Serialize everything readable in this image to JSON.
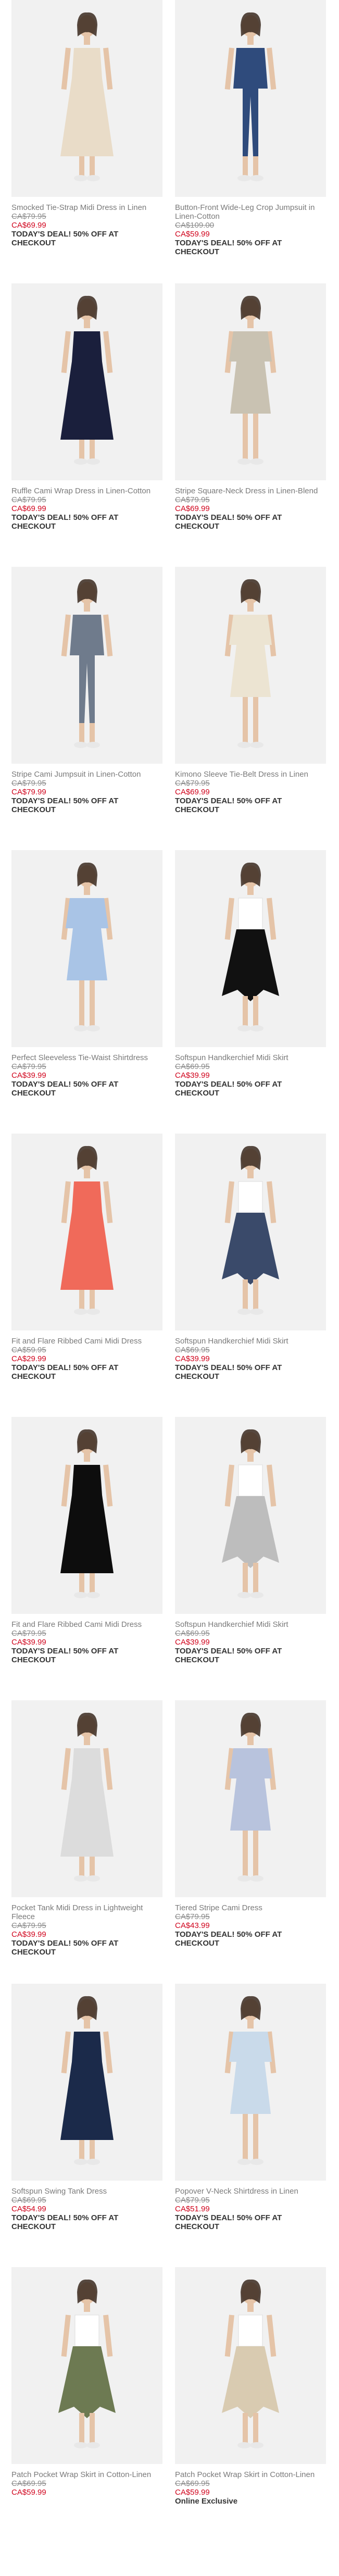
{
  "products": [
    {
      "name": "Smocked Tie-Strap Midi Dress in Linen",
      "original_price": "CA$79.95",
      "sale_price": "CA$69.99",
      "promo": "TODAY'S DEAL! 50% OFF AT CHECKOUT",
      "dress_color": "#e9dcc8",
      "bg": "#f1f1f1",
      "style": "dress"
    },
    {
      "name": "Button-Front Wide-Leg Crop Jumpsuit in Linen-Cotton",
      "original_price": "CA$109.00",
      "sale_price": "CA$59.99",
      "promo": "TODAY'S DEAL! 50% OFF AT CHECKOUT",
      "dress_color": "#2f4b7c",
      "bg": "#f1f1f1",
      "style": "jumpsuit"
    },
    {
      "name": "Ruffle Cami Wrap Dress in Linen-Cotton",
      "original_price": "CA$79.95",
      "sale_price": "CA$69.99",
      "promo": "TODAY'S DEAL! 50% OFF AT CHECKOUT",
      "dress_color": "#1a1f3c",
      "bg": "#f1f1f1",
      "style": "dress"
    },
    {
      "name": "Stripe Square-Neck Dress in Linen-Blend",
      "original_price": "CA$79.95",
      "sale_price": "CA$69.99",
      "promo": "TODAY'S DEAL! 50% OFF AT CHECKOUT",
      "dress_color": "#c9c2b2",
      "bg": "#f1f1f1",
      "style": "short"
    },
    {
      "name": "Stripe Cami Jumpsuit in Linen-Cotton",
      "original_price": "CA$79.95",
      "sale_price": "CA$79.99",
      "promo": "TODAY'S DEAL! 50% OFF AT CHECKOUT",
      "dress_color": "#6f7b8c",
      "bg": "#f1f1f1",
      "style": "jumpsuit"
    },
    {
      "name": "Kimono Sleeve Tie-Belt Dress in Linen",
      "original_price": "CA$79.95",
      "sale_price": "CA$69.99",
      "promo": "TODAY'S DEAL! 50% OFF AT CHECKOUT",
      "dress_color": "#ece4d2",
      "bg": "#f1f1f1",
      "style": "short"
    },
    {
      "name": "Perfect Sleeveless Tie-Waist Shirtdress",
      "original_price": "CA$79.95",
      "sale_price": "CA$39.99",
      "promo": "TODAY'S DEAL! 50% OFF AT CHECKOUT",
      "dress_color": "#a9c4e6",
      "bg": "#f1f1f1",
      "style": "short"
    },
    {
      "name": "Softspun Handkerchief Midi Skirt",
      "original_price": "CA$69.95",
      "sale_price": "CA$39.99",
      "promo": "TODAY'S DEAL! 50% OFF AT CHECKOUT",
      "dress_color": "#111111",
      "bg": "#f1f1f1",
      "style": "skirt"
    },
    {
      "name": "Fit and Flare Ribbed Cami Midi Dress",
      "original_price": "CA$59.95",
      "sale_price": "CA$29.99",
      "promo": "TODAY'S DEAL! 50% OFF AT CHECKOUT",
      "dress_color": "#f06a5a",
      "bg": "#f1f1f1",
      "style": "dress"
    },
    {
      "name": "Softspun Handkerchief Midi Skirt",
      "original_price": "CA$69.95",
      "sale_price": "CA$39.99",
      "promo": "TODAY'S DEAL! 50% OFF AT CHECKOUT",
      "dress_color": "#3a4a6a",
      "bg": "#f1f1f1",
      "style": "skirt"
    },
    {
      "name": "Fit and Flare Ribbed Cami Midi Dress",
      "original_price": "CA$79.95",
      "sale_price": "CA$39.99",
      "promo": "TODAY'S DEAL! 50% OFF AT CHECKOUT",
      "dress_color": "#0d0d0d",
      "bg": "#f1f1f1",
      "style": "dress"
    },
    {
      "name": "Softspun Handkerchief Midi Skirt",
      "original_price": "CA$69.95",
      "sale_price": "CA$39.99",
      "promo": "TODAY'S DEAL! 50% OFF AT CHECKOUT",
      "dress_color": "#bdbdbd",
      "bg": "#f1f1f1",
      "style": "skirt"
    },
    {
      "name": "Pocket Tank Midi Dress in Lightweight Fleece",
      "original_price": "CA$79.95",
      "sale_price": "CA$39.99",
      "promo": "TODAY'S DEAL! 50% OFF AT CHECKOUT",
      "dress_color": "#dcdcdc",
      "bg": "#f1f1f1",
      "style": "dress"
    },
    {
      "name": "Tiered Stripe Cami Dress",
      "original_price": "CA$79.95",
      "sale_price": "CA$43.99",
      "promo": "TODAY'S DEAL! 50% OFF AT CHECKOUT",
      "dress_color": "#b8c3dd",
      "bg": "#f1f1f1",
      "style": "short"
    },
    {
      "name": "Softspun Swing Tank Dress",
      "original_price": "CA$69.95",
      "sale_price": "CA$54.99",
      "promo": "TODAY'S DEAL! 50% OFF AT CHECKOUT",
      "dress_color": "#1b2a4a",
      "bg": "#f1f1f1",
      "style": "dress"
    },
    {
      "name": "Popover V-Neck Shirtdress in Linen",
      "original_price": "CA$79.95",
      "sale_price": "CA$51.99",
      "promo": "TODAY'S DEAL! 50% OFF AT CHECKOUT",
      "dress_color": "#c9daea",
      "bg": "#f1f1f1",
      "style": "short"
    },
    {
      "name": "Patch Pocket Wrap Skirt in Cotton-Linen",
      "original_price": "CA$69.95",
      "sale_price": "CA$59.99",
      "promo": "",
      "dress_color": "#6d7a52",
      "bg": "#f1f1f1",
      "style": "skirt"
    },
    {
      "name": "Patch Pocket Wrap Skirt in Cotton-Linen",
      "original_price": "CA$69.95",
      "sale_price": "CA$59.99",
      "promo": "",
      "badge": "Online Exclusive",
      "dress_color": "#d9cbb1",
      "bg": "#f1f1f1",
      "style": "skirt"
    }
  ]
}
